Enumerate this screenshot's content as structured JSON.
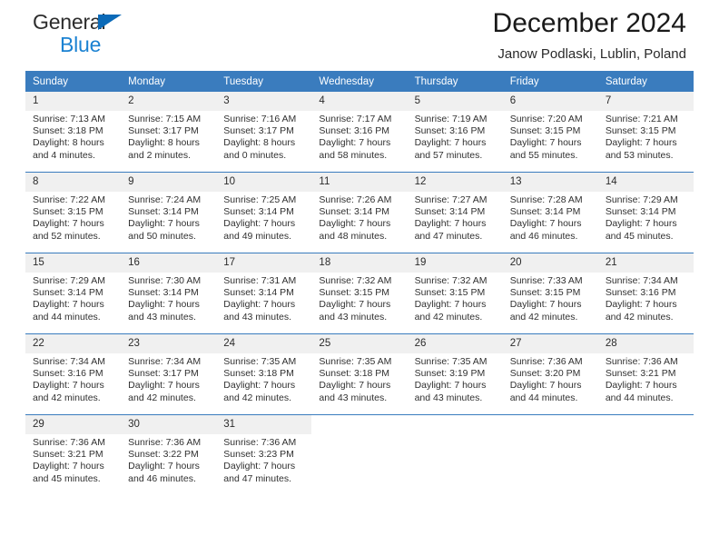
{
  "brand": {
    "name_part1": "General",
    "name_part2": "Blue",
    "accent_color": "#1b82d2",
    "triangle_color": "#0b6ab8",
    "logo_icon": "triangle-icon"
  },
  "header": {
    "title": "December 2024",
    "subtitle": "Janow Podlaski, Lublin, Poland"
  },
  "table": {
    "header_bg": "#3a7cbe",
    "daynum_bg": "#f0f0f0",
    "columns": [
      "Sunday",
      "Monday",
      "Tuesday",
      "Wednesday",
      "Thursday",
      "Friday",
      "Saturday"
    ]
  },
  "weeks": [
    [
      {
        "day": "1",
        "sunrise": "Sunrise: 7:13 AM",
        "sunset": "Sunset: 3:18 PM",
        "daylight_line1": "Daylight: 8 hours",
        "daylight_line2": "and 4 minutes."
      },
      {
        "day": "2",
        "sunrise": "Sunrise: 7:15 AM",
        "sunset": "Sunset: 3:17 PM",
        "daylight_line1": "Daylight: 8 hours",
        "daylight_line2": "and 2 minutes."
      },
      {
        "day": "3",
        "sunrise": "Sunrise: 7:16 AM",
        "sunset": "Sunset: 3:17 PM",
        "daylight_line1": "Daylight: 8 hours",
        "daylight_line2": "and 0 minutes."
      },
      {
        "day": "4",
        "sunrise": "Sunrise: 7:17 AM",
        "sunset": "Sunset: 3:16 PM",
        "daylight_line1": "Daylight: 7 hours",
        "daylight_line2": "and 58 minutes."
      },
      {
        "day": "5",
        "sunrise": "Sunrise: 7:19 AM",
        "sunset": "Sunset: 3:16 PM",
        "daylight_line1": "Daylight: 7 hours",
        "daylight_line2": "and 57 minutes."
      },
      {
        "day": "6",
        "sunrise": "Sunrise: 7:20 AM",
        "sunset": "Sunset: 3:15 PM",
        "daylight_line1": "Daylight: 7 hours",
        "daylight_line2": "and 55 minutes."
      },
      {
        "day": "7",
        "sunrise": "Sunrise: 7:21 AM",
        "sunset": "Sunset: 3:15 PM",
        "daylight_line1": "Daylight: 7 hours",
        "daylight_line2": "and 53 minutes."
      }
    ],
    [
      {
        "day": "8",
        "sunrise": "Sunrise: 7:22 AM",
        "sunset": "Sunset: 3:15 PM",
        "daylight_line1": "Daylight: 7 hours",
        "daylight_line2": "and 52 minutes."
      },
      {
        "day": "9",
        "sunrise": "Sunrise: 7:24 AM",
        "sunset": "Sunset: 3:14 PM",
        "daylight_line1": "Daylight: 7 hours",
        "daylight_line2": "and 50 minutes."
      },
      {
        "day": "10",
        "sunrise": "Sunrise: 7:25 AM",
        "sunset": "Sunset: 3:14 PM",
        "daylight_line1": "Daylight: 7 hours",
        "daylight_line2": "and 49 minutes."
      },
      {
        "day": "11",
        "sunrise": "Sunrise: 7:26 AM",
        "sunset": "Sunset: 3:14 PM",
        "daylight_line1": "Daylight: 7 hours",
        "daylight_line2": "and 48 minutes."
      },
      {
        "day": "12",
        "sunrise": "Sunrise: 7:27 AM",
        "sunset": "Sunset: 3:14 PM",
        "daylight_line1": "Daylight: 7 hours",
        "daylight_line2": "and 47 minutes."
      },
      {
        "day": "13",
        "sunrise": "Sunrise: 7:28 AM",
        "sunset": "Sunset: 3:14 PM",
        "daylight_line1": "Daylight: 7 hours",
        "daylight_line2": "and 46 minutes."
      },
      {
        "day": "14",
        "sunrise": "Sunrise: 7:29 AM",
        "sunset": "Sunset: 3:14 PM",
        "daylight_line1": "Daylight: 7 hours",
        "daylight_line2": "and 45 minutes."
      }
    ],
    [
      {
        "day": "15",
        "sunrise": "Sunrise: 7:29 AM",
        "sunset": "Sunset: 3:14 PM",
        "daylight_line1": "Daylight: 7 hours",
        "daylight_line2": "and 44 minutes."
      },
      {
        "day": "16",
        "sunrise": "Sunrise: 7:30 AM",
        "sunset": "Sunset: 3:14 PM",
        "daylight_line1": "Daylight: 7 hours",
        "daylight_line2": "and 43 minutes."
      },
      {
        "day": "17",
        "sunrise": "Sunrise: 7:31 AM",
        "sunset": "Sunset: 3:14 PM",
        "daylight_line1": "Daylight: 7 hours",
        "daylight_line2": "and 43 minutes."
      },
      {
        "day": "18",
        "sunrise": "Sunrise: 7:32 AM",
        "sunset": "Sunset: 3:15 PM",
        "daylight_line1": "Daylight: 7 hours",
        "daylight_line2": "and 43 minutes."
      },
      {
        "day": "19",
        "sunrise": "Sunrise: 7:32 AM",
        "sunset": "Sunset: 3:15 PM",
        "daylight_line1": "Daylight: 7 hours",
        "daylight_line2": "and 42 minutes."
      },
      {
        "day": "20",
        "sunrise": "Sunrise: 7:33 AM",
        "sunset": "Sunset: 3:15 PM",
        "daylight_line1": "Daylight: 7 hours",
        "daylight_line2": "and 42 minutes."
      },
      {
        "day": "21",
        "sunrise": "Sunrise: 7:34 AM",
        "sunset": "Sunset: 3:16 PM",
        "daylight_line1": "Daylight: 7 hours",
        "daylight_line2": "and 42 minutes."
      }
    ],
    [
      {
        "day": "22",
        "sunrise": "Sunrise: 7:34 AM",
        "sunset": "Sunset: 3:16 PM",
        "daylight_line1": "Daylight: 7 hours",
        "daylight_line2": "and 42 minutes."
      },
      {
        "day": "23",
        "sunrise": "Sunrise: 7:34 AM",
        "sunset": "Sunset: 3:17 PM",
        "daylight_line1": "Daylight: 7 hours",
        "daylight_line2": "and 42 minutes."
      },
      {
        "day": "24",
        "sunrise": "Sunrise: 7:35 AM",
        "sunset": "Sunset: 3:18 PM",
        "daylight_line1": "Daylight: 7 hours",
        "daylight_line2": "and 42 minutes."
      },
      {
        "day": "25",
        "sunrise": "Sunrise: 7:35 AM",
        "sunset": "Sunset: 3:18 PM",
        "daylight_line1": "Daylight: 7 hours",
        "daylight_line2": "and 43 minutes."
      },
      {
        "day": "26",
        "sunrise": "Sunrise: 7:35 AM",
        "sunset": "Sunset: 3:19 PM",
        "daylight_line1": "Daylight: 7 hours",
        "daylight_line2": "and 43 minutes."
      },
      {
        "day": "27",
        "sunrise": "Sunrise: 7:36 AM",
        "sunset": "Sunset: 3:20 PM",
        "daylight_line1": "Daylight: 7 hours",
        "daylight_line2": "and 44 minutes."
      },
      {
        "day": "28",
        "sunrise": "Sunrise: 7:36 AM",
        "sunset": "Sunset: 3:21 PM",
        "daylight_line1": "Daylight: 7 hours",
        "daylight_line2": "and 44 minutes."
      }
    ],
    [
      {
        "day": "29",
        "sunrise": "Sunrise: 7:36 AM",
        "sunset": "Sunset: 3:21 PM",
        "daylight_line1": "Daylight: 7 hours",
        "daylight_line2": "and 45 minutes."
      },
      {
        "day": "30",
        "sunrise": "Sunrise: 7:36 AM",
        "sunset": "Sunset: 3:22 PM",
        "daylight_line1": "Daylight: 7 hours",
        "daylight_line2": "and 46 minutes."
      },
      {
        "day": "31",
        "sunrise": "Sunrise: 7:36 AM",
        "sunset": "Sunset: 3:23 PM",
        "daylight_line1": "Daylight: 7 hours",
        "daylight_line2": "and 47 minutes."
      },
      {
        "day": "",
        "sunrise": "",
        "sunset": "",
        "daylight_line1": "",
        "daylight_line2": ""
      },
      {
        "day": "",
        "sunrise": "",
        "sunset": "",
        "daylight_line1": "",
        "daylight_line2": ""
      },
      {
        "day": "",
        "sunrise": "",
        "sunset": "",
        "daylight_line1": "",
        "daylight_line2": ""
      },
      {
        "day": "",
        "sunrise": "",
        "sunset": "",
        "daylight_line1": "",
        "daylight_line2": ""
      }
    ]
  ]
}
